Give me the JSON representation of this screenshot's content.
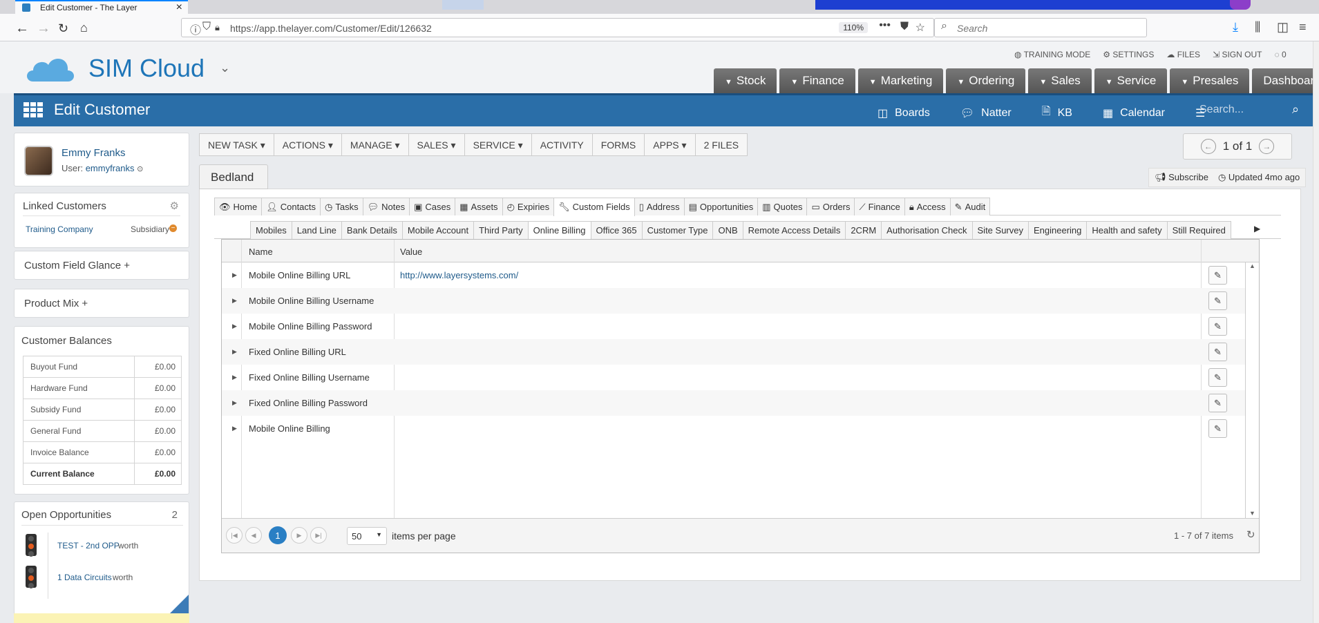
{
  "browser": {
    "tab_title": "Edit Customer - The Layer",
    "tab_close": "×",
    "url": "https://app.thelayer.com/Customer/Edit/126632",
    "zoom": "110%",
    "search_placeholder": "Search"
  },
  "app": {
    "brand": "SIM Cloud",
    "top_links": [
      "TRAINING MODE",
      "SETTINGS",
      "FILES",
      "SIGN OUT",
      "0"
    ],
    "module_tabs": [
      "Stock",
      "Finance",
      "Marketing",
      "Ordering",
      "Sales",
      "Service",
      "Presales",
      "Dashboard"
    ],
    "page_title": "Edit Customer",
    "blue_links": [
      "Boards",
      "Natter",
      "KB",
      "Calendar"
    ],
    "blue_search_placeholder": "Search..."
  },
  "sidebar": {
    "user": {
      "name": "Emmy Franks",
      "label": "User:",
      "username": "emmyfranks"
    },
    "linked": {
      "title": "Linked Customers",
      "company": "Training Company",
      "relation": "Subsidiary"
    },
    "custom_field_glance": "Custom Field Glance +",
    "product_mix": "Product Mix +",
    "balances": {
      "title": "Customer Balances",
      "rows": [
        {
          "label": "Buyout Fund",
          "value": "£0.00"
        },
        {
          "label": "Hardware Fund",
          "value": "£0.00"
        },
        {
          "label": "Subsidy Fund",
          "value": "£0.00"
        },
        {
          "label": "General Fund",
          "value": "£0.00"
        },
        {
          "label": "Invoice Balance",
          "value": "£0.00"
        },
        {
          "label": "Current Balance",
          "value": "£0.00"
        }
      ]
    },
    "opportunities": {
      "title": "Open Opportunities",
      "count": "2",
      "items": [
        {
          "name": "TEST - 2nd OPP",
          "suffix": "worth"
        },
        {
          "name": "1 Data Circuits",
          "suffix": "worth"
        }
      ]
    }
  },
  "toolbar": {
    "buttons": [
      "NEW TASK ▾",
      "ACTIONS ▾",
      "MANAGE ▾",
      "SALES ▾",
      "SERVICE ▾",
      "ACTIVITY",
      "FORMS",
      "APPS ▾",
      "2 FILES"
    ],
    "pager": "1 of 1"
  },
  "account": {
    "name": "Bedland",
    "subscribe": "Subscribe",
    "updated": "Updated 4mo ago"
  },
  "tabs_primary": [
    "Home",
    "Contacts",
    "Tasks",
    "Notes",
    "Cases",
    "Assets",
    "Expiries",
    "Custom Fields",
    "Address",
    "Opportunities",
    "Quotes",
    "Orders",
    "Finance",
    "Access",
    "Audit"
  ],
  "tabs_primary_active": "Custom Fields",
  "tabs_secondary": [
    "Mobiles",
    "Land Line",
    "Bank Details",
    "Mobile Account",
    "Third Party",
    "Online Billing",
    "Office 365",
    "Customer Type",
    "ONB",
    "Remote Access Details",
    "2CRM",
    "Authorisation Check",
    "Site Survey",
    "Engineering",
    "Health and safety",
    "Still Required"
  ],
  "tabs_secondary_active": "Online Billing",
  "grid": {
    "columns": [
      "Name",
      "Value"
    ],
    "rows": [
      {
        "name": "Mobile Online Billing URL",
        "value": "http://www.layersystems.com/"
      },
      {
        "name": "Mobile Online Billing Username",
        "value": ""
      },
      {
        "name": "Mobile Online Billing Password",
        "value": ""
      },
      {
        "name": "Fixed Online Billing URL",
        "value": ""
      },
      {
        "name": "Fixed Online Billing Username",
        "value": ""
      },
      {
        "name": "Fixed Online Billing Password",
        "value": ""
      },
      {
        "name": "Mobile Online Billing",
        "value": ""
      }
    ],
    "footer": {
      "current_page": "1",
      "page_size": "50",
      "per_page_label": "items per page",
      "summary": "1 - 7 of 7 items"
    }
  },
  "colors": {
    "brand_blue": "#2a6ea8",
    "module_tab": "#666666",
    "link": "#1e5a8a"
  }
}
